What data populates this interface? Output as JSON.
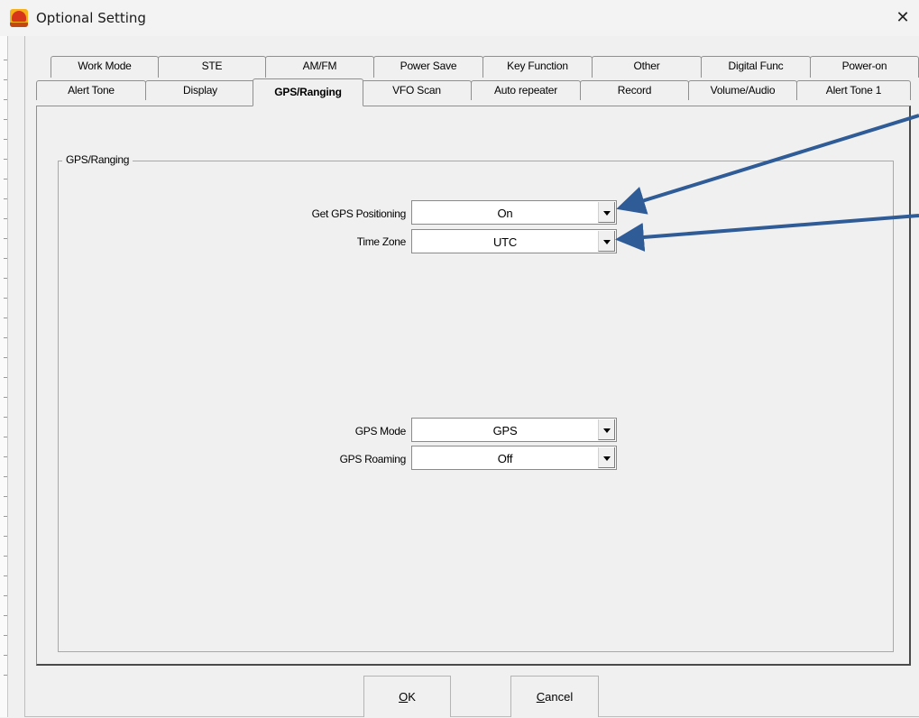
{
  "window": {
    "title": "Optional Setting",
    "close_glyph": "✕",
    "app_icon": "app-logo-icon"
  },
  "tabs": {
    "row1": [
      "Work Mode",
      "STE",
      "AM/FM",
      "Power Save",
      "Key Function",
      "Other",
      "Digital Func",
      "Power-on"
    ],
    "row2": [
      "Alert Tone",
      "Display",
      "GPS/Ranging",
      "VFO Scan",
      "Auto repeater",
      "Record",
      "Volume/Audio",
      "Alert Tone 1"
    ],
    "active": "GPS/Ranging"
  },
  "group": {
    "label": "GPS/Ranging"
  },
  "fields": {
    "get_gps_positioning": {
      "label": "Get GPS Positioning",
      "value": "On"
    },
    "time_zone": {
      "label": "Time Zone",
      "value": "UTC"
    },
    "gps_mode": {
      "label": "GPS Mode",
      "value": "GPS"
    },
    "gps_roaming": {
      "label": "GPS Roaming",
      "value": "Off"
    }
  },
  "buttons": {
    "ok": {
      "accel": "O",
      "rest": "K"
    },
    "cancel": {
      "accel": "C",
      "rest": "ancel"
    }
  },
  "colors": {
    "annotation_arrow": "#2f5b97",
    "app_icon": "#f7b21a"
  }
}
